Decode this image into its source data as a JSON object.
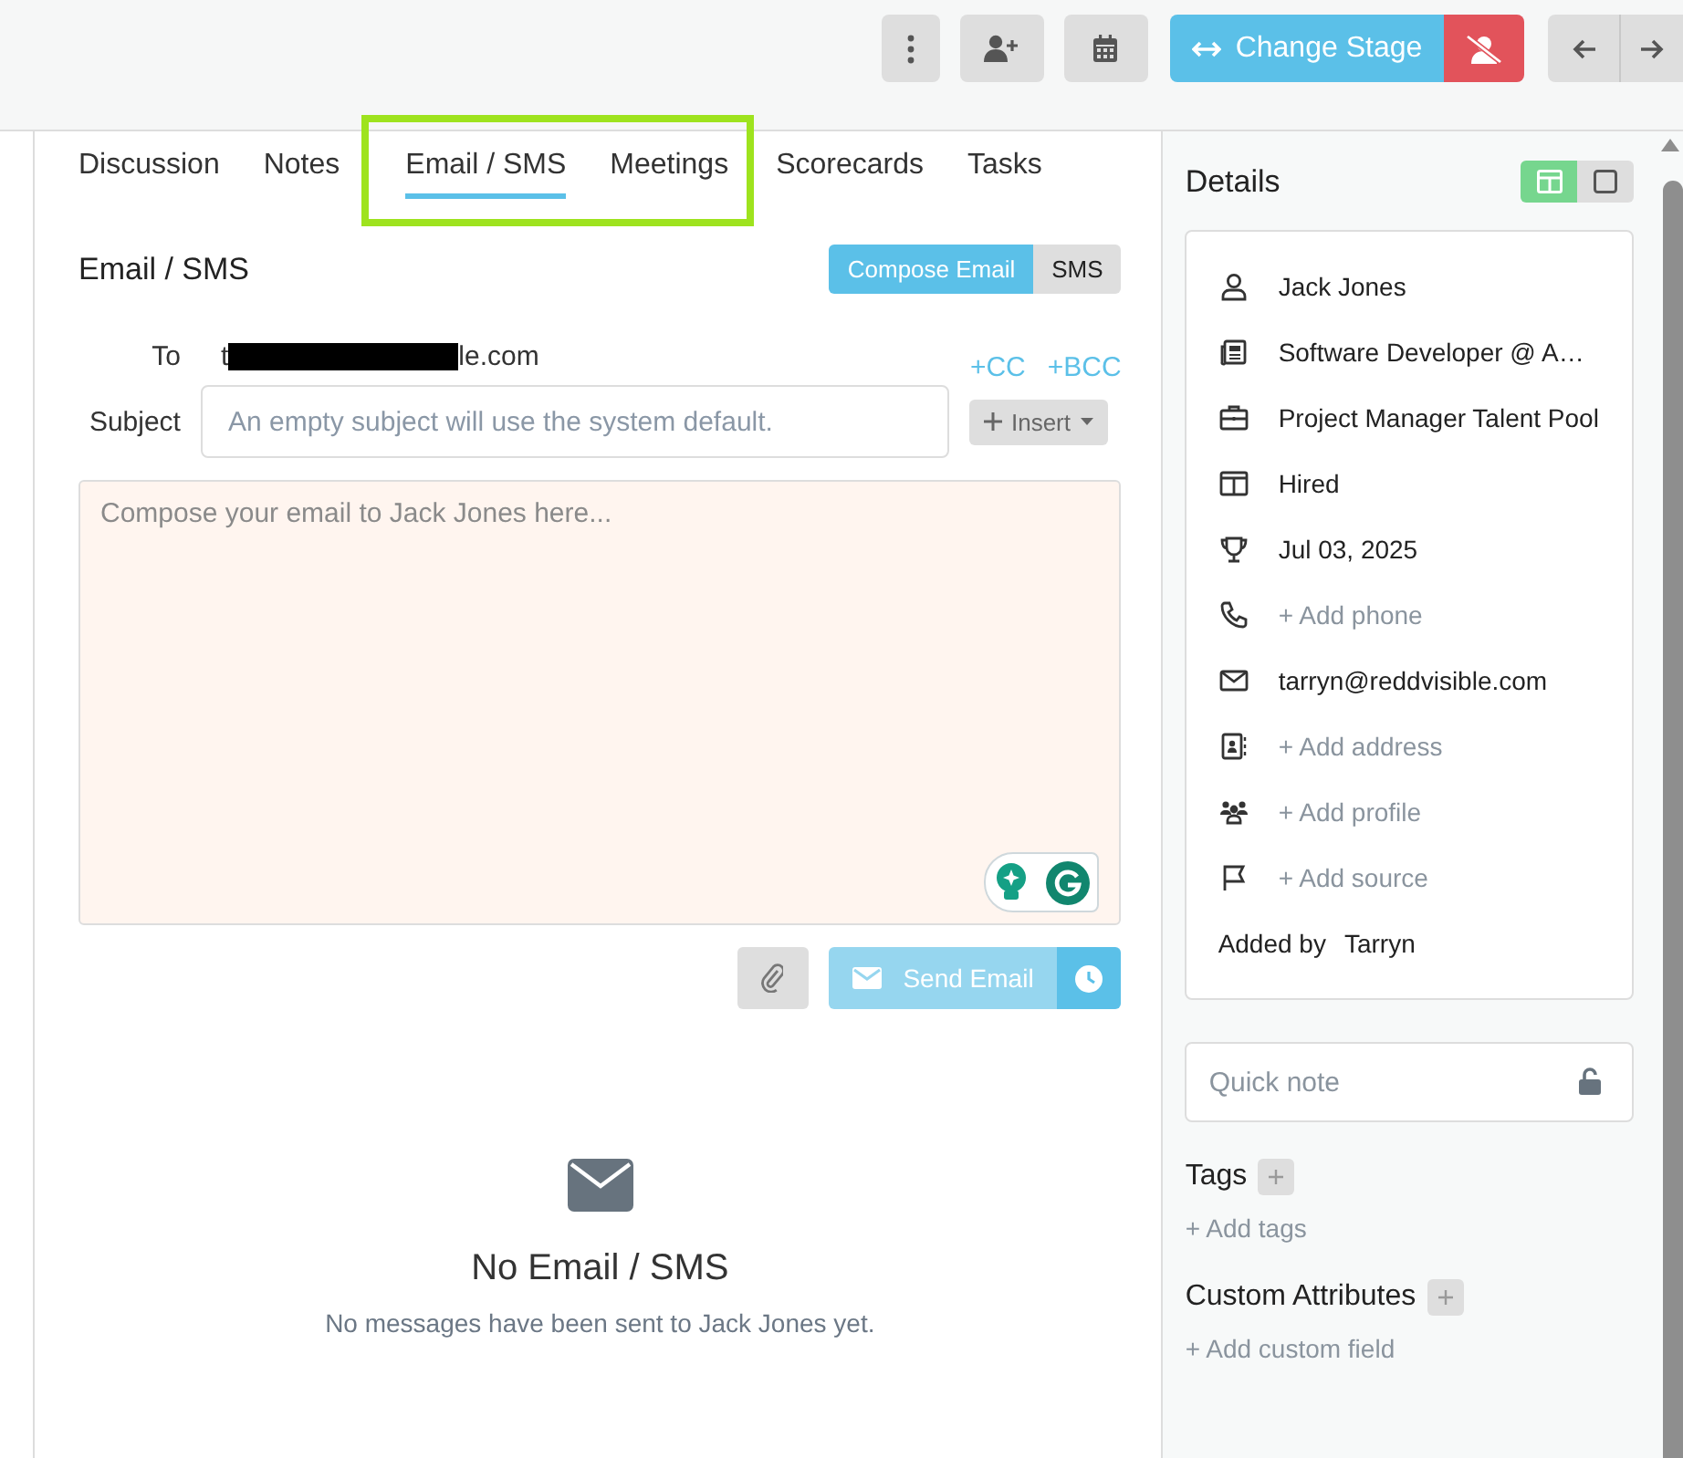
{
  "toolbar": {
    "buttons": [
      {
        "kind": "more"
      },
      {
        "kind": "add-user"
      },
      {
        "kind": "calendar"
      },
      {
        "kind": "stage",
        "label": "Change Stage"
      },
      {
        "kind": "reject"
      },
      {
        "kind": "prev"
      },
      {
        "kind": "next"
      }
    ]
  },
  "tabs": [
    {
      "label": "Discussion",
      "selected": false,
      "highlighted": false
    },
    {
      "label": "Notes",
      "selected": false,
      "highlighted": false
    },
    {
      "label": "Email / SMS",
      "selected": true,
      "highlighted": true
    },
    {
      "label": "Meetings",
      "selected": false,
      "highlighted": true
    },
    {
      "label": "Scorecards",
      "selected": false,
      "highlighted": false
    },
    {
      "label": "Tasks",
      "selected": false,
      "highlighted": false
    }
  ],
  "composer": {
    "title": "Email / SMS",
    "modes": [
      {
        "label": "Compose Email",
        "selected": true
      },
      {
        "label": "SMS",
        "selected": false
      }
    ],
    "to": {
      "label": "To",
      "start": "t",
      "end": "le.com",
      "redacted": true
    },
    "cc": "+CC",
    "bcc": "+BCC",
    "subject": {
      "label": "Subject",
      "placeholder": "An empty subject will use the system default."
    },
    "insert": "Insert",
    "body": {
      "placeholder": "Compose your email to Jack Jones here..."
    },
    "send": {
      "label": "Send Email",
      "disabled": true
    }
  },
  "empty": {
    "title": "No Email / SMS",
    "text": "No messages have been sent to Jack Jones yet."
  },
  "details": {
    "title": "Details",
    "views": [
      {
        "selected": true
      },
      {
        "selected": false
      }
    ],
    "items": [
      {
        "kind": "value",
        "text": "Jack Jones"
      },
      {
        "kind": "value",
        "text": "Software Developer @ A…"
      },
      {
        "kind": "value",
        "text": "Project Manager Talent Pool"
      },
      {
        "kind": "value",
        "text": "Hired"
      },
      {
        "kind": "value",
        "text": "Jul 03, 2025"
      },
      {
        "kind": "add",
        "text": "+ Add phone"
      },
      {
        "kind": "value",
        "text": "tarryn@reddvisible.com"
      },
      {
        "kind": "add",
        "text": "+ Add address"
      },
      {
        "kind": "add",
        "text": "+ Add profile"
      },
      {
        "kind": "add",
        "text": "+ Add source"
      }
    ],
    "added_by": {
      "label": "Added by",
      "value": "Tarryn"
    }
  },
  "quick_note": {
    "placeholder": "Quick note"
  },
  "tags": {
    "title": "Tags",
    "add": "+ Add tags"
  },
  "custom_attributes": {
    "title": "Custom Attributes",
    "add": "+ Add custom field"
  }
}
